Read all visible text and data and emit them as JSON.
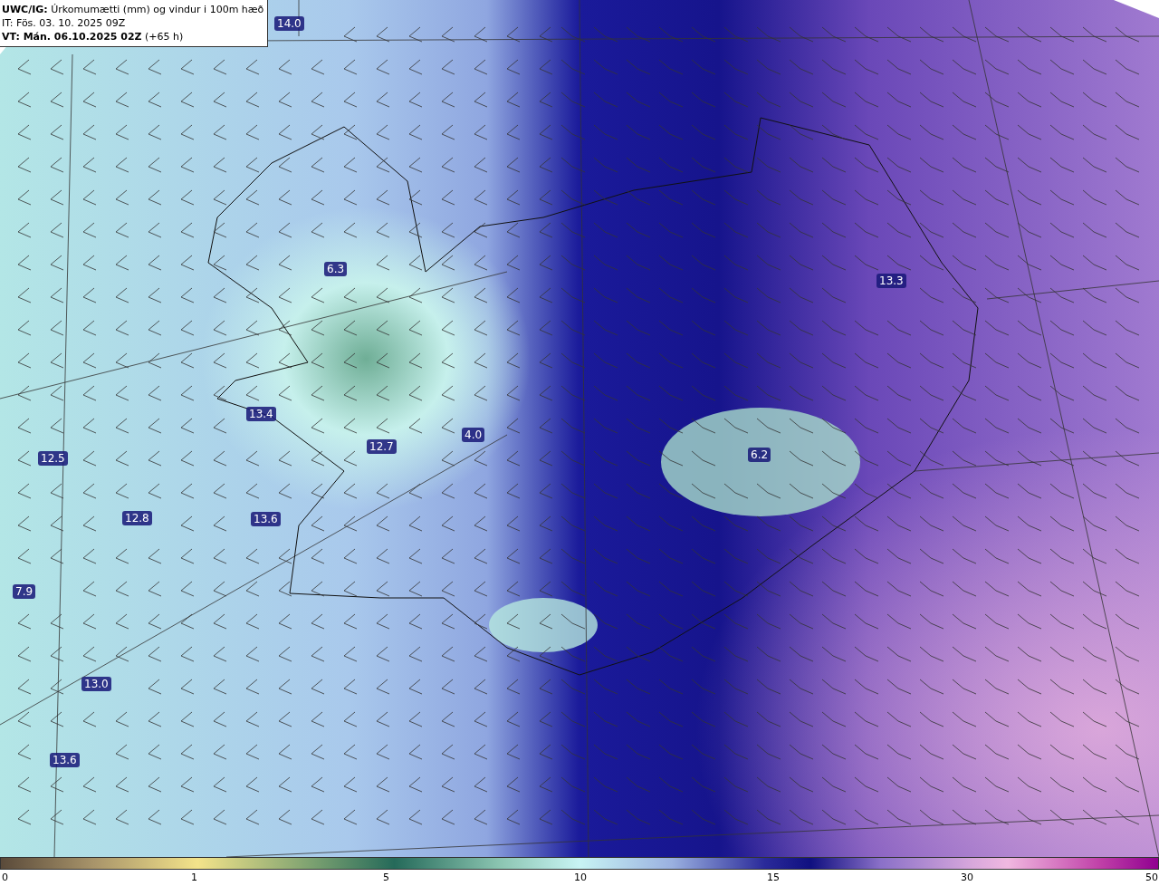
{
  "header": {
    "title": "**UWC/IG:** Úrkomumætti (mm) og vindur i 100m hæð",
    "issue_time": "IT: Fös. 03. 10. 2025 09Z",
    "valid_time": "**VT: Mán. 06.10.2025 02Z** (+65 h)"
  },
  "map_labels": [
    "14.0",
    "6.3",
    "13.3",
    "13.4",
    "4.0",
    "12.7",
    "12.5",
    "6.2",
    "12.8",
    "13.6",
    "7.9",
    "13.0",
    "13.6"
  ],
  "colorbar": {
    "ticks": [
      "0",
      "1",
      "5",
      "10",
      "15",
      "30",
      "50"
    ]
  }
}
